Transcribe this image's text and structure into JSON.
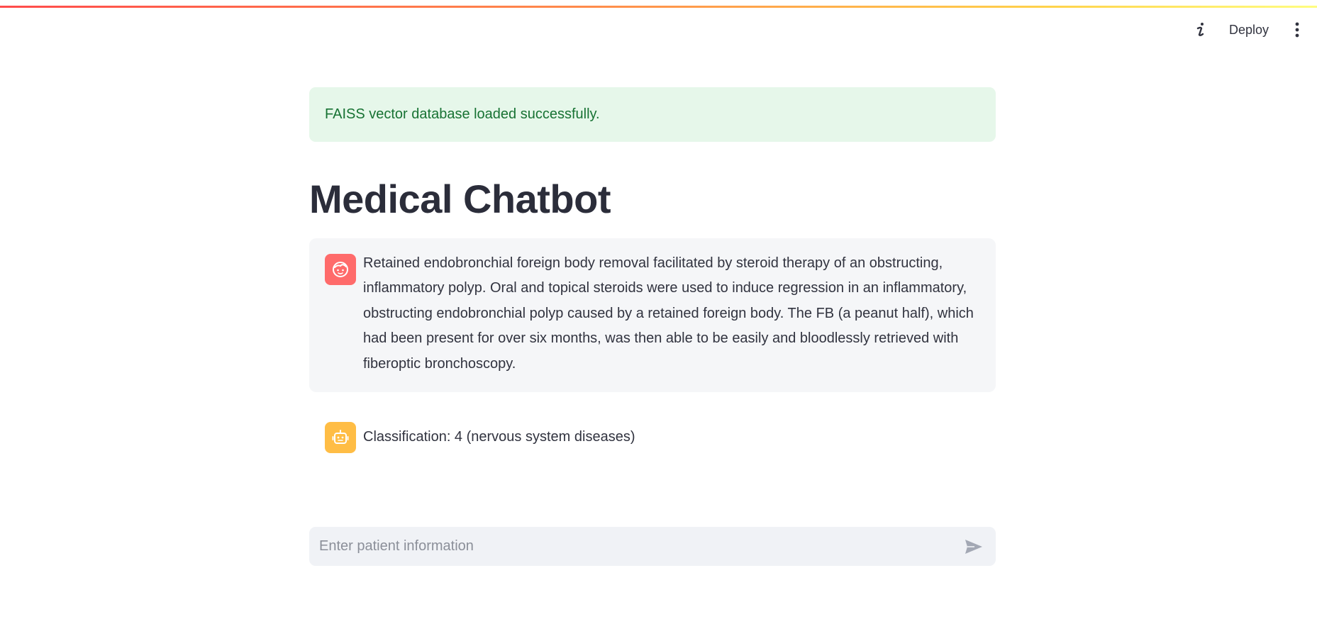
{
  "header": {
    "info_icon": "info-icon",
    "deploy_label": "Deploy",
    "menu_icon": "more-vertical-icon"
  },
  "alert": {
    "text": "FAISS vector database loaded successfully.",
    "color": "#177233",
    "background": "#e6f7ea"
  },
  "page": {
    "title": "Medical Chatbot"
  },
  "messages": [
    {
      "role": "user",
      "avatar_icon": "face-icon",
      "avatar_color": "#ff6b6b",
      "text": "Retained endobronchial foreign body removal facilitated by steroid therapy of an obstructing, inflammatory polyp. Oral and topical steroids were used to induce regression in an inflammatory, obstructing endobronchial polyp caused by a retained foreign body. The FB (a peanut half), which had been present for over six months, was then able to be easily and bloodlessly retrieved with fiberoptic bronchoscopy."
    },
    {
      "role": "assistant",
      "avatar_icon": "robot-icon",
      "avatar_color": "#ffbd45",
      "text": "Classification: 4 (nervous system diseases)"
    }
  ],
  "chat_input": {
    "placeholder": "Enter patient information",
    "send_icon": "send-icon"
  }
}
